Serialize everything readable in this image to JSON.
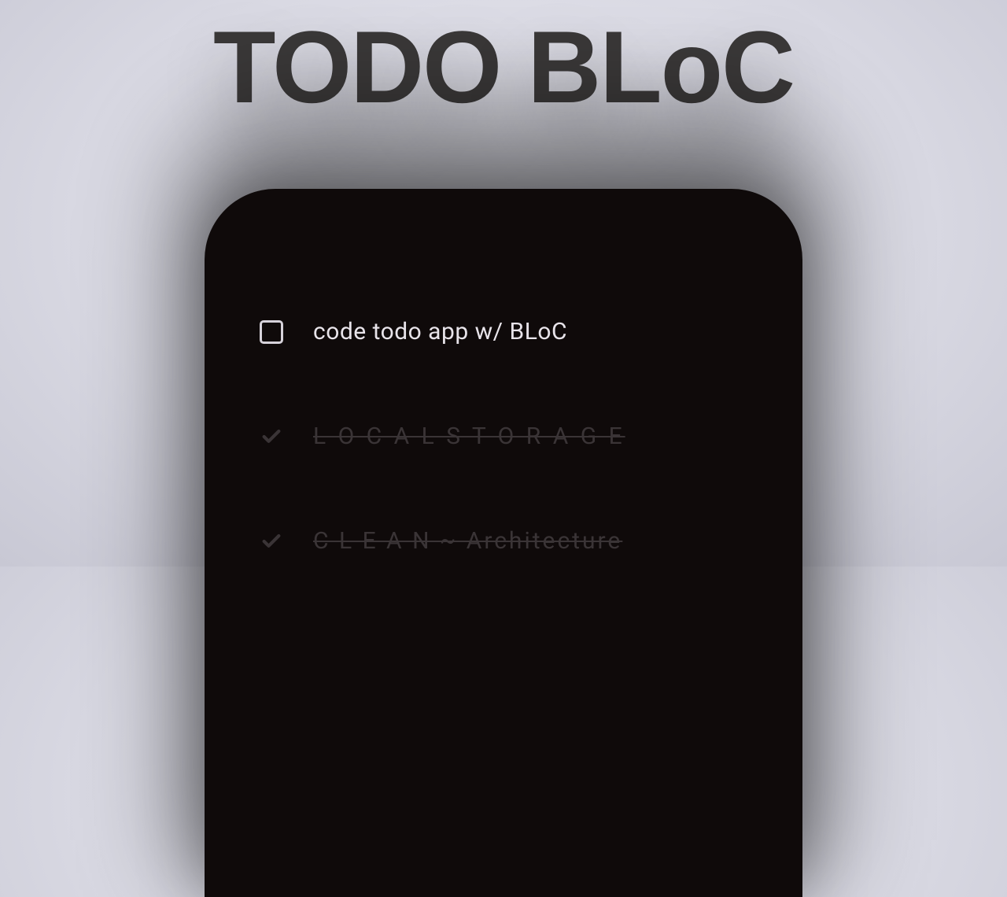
{
  "header": {
    "word1": "TODO",
    "word2": "BLoC"
  },
  "todos": [
    {
      "label": "code todo app w/ BLoC",
      "done": false
    },
    {
      "label": "L O C A L   S T O R A G E",
      "done": true
    },
    {
      "label": "C L E A N ~ Architecture",
      "done": true
    }
  ],
  "colors": {
    "title": "#3a3838",
    "phone_bg": "#0f0a0a",
    "text_active": "#e8e4ea",
    "text_done": "#3a3436",
    "checkbox_border": "#d6d2da"
  }
}
